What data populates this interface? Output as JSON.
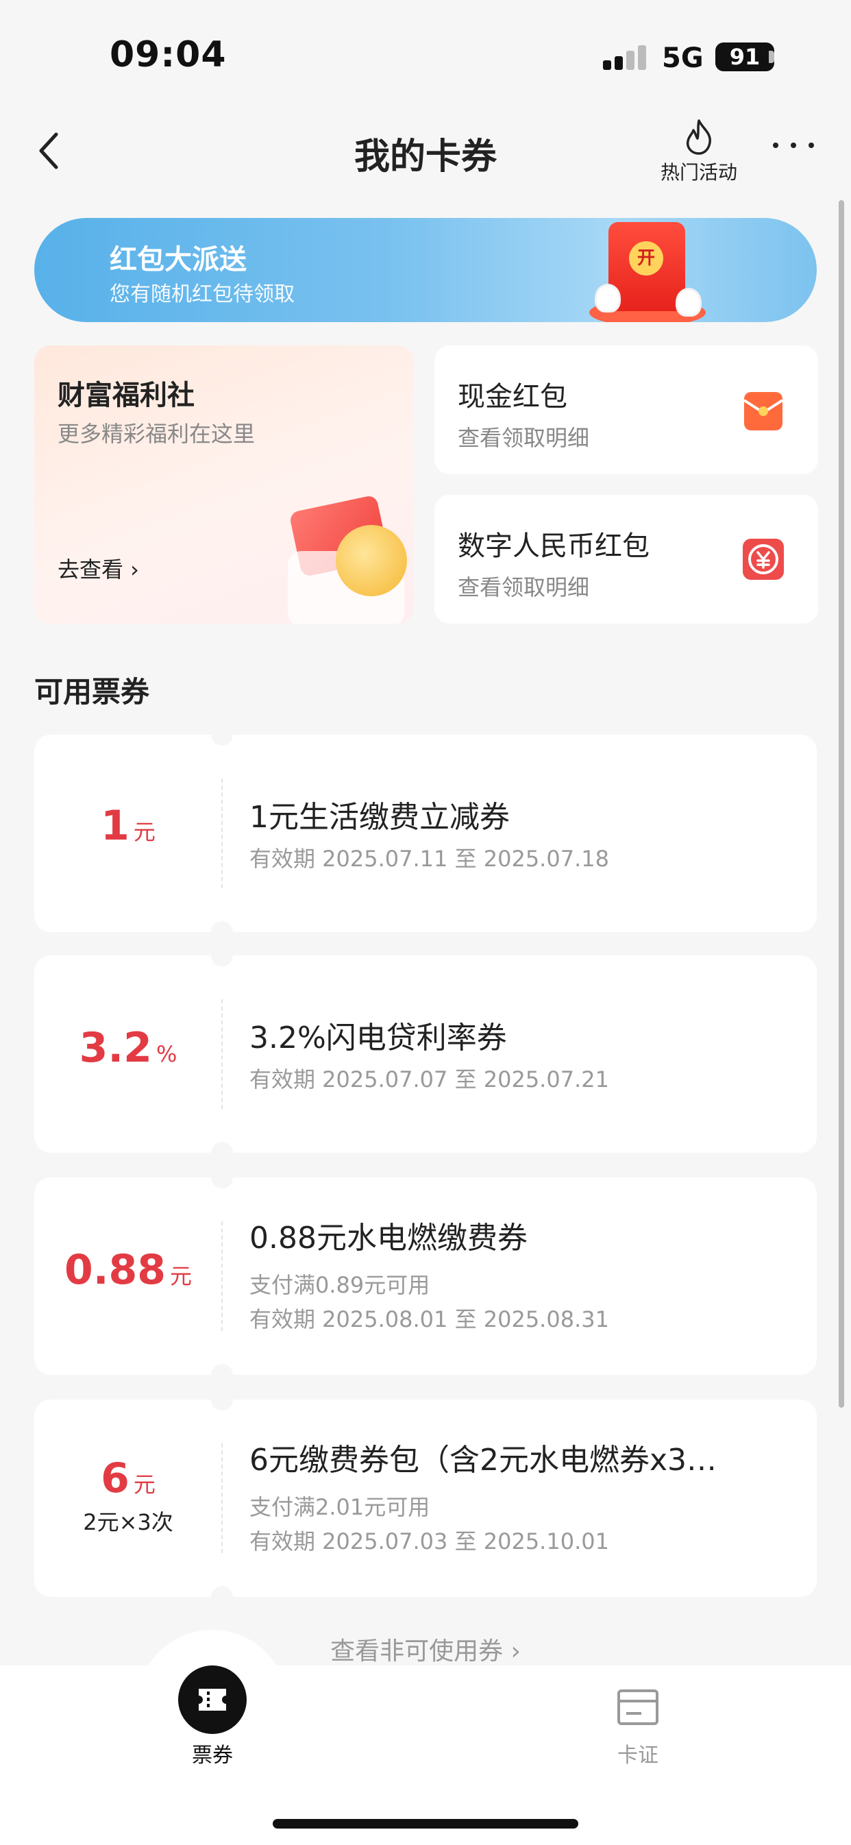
{
  "status_bar": {
    "time": "09:04",
    "network": "5G",
    "battery": "91"
  },
  "nav": {
    "title": "我的卡券",
    "hot_label": "热门活动"
  },
  "banner": {
    "title": "红包大派送",
    "subtitle": "您有随机红包待领取",
    "seal": "开"
  },
  "wealth": {
    "title": "财富福利社",
    "subtitle": "更多精彩福利在这里",
    "link": "去查看 ›"
  },
  "cash_redpacket": {
    "title": "现金红包",
    "subtitle": "查看领取明细"
  },
  "ecny_redpacket": {
    "title": "数字人民币红包",
    "subtitle": "查看领取明细"
  },
  "section": {
    "title": "可用票券"
  },
  "coupons": [
    {
      "amount": "1",
      "unit": "元",
      "note": "",
      "title": "1元生活缴费立减券",
      "condition": "",
      "validity": "有效期 2025.07.11 至 2025.07.18"
    },
    {
      "amount": "3.2",
      "unit": "%",
      "note": "",
      "title": "3.2%闪电贷利率券",
      "condition": "",
      "validity": "有效期 2025.07.07 至 2025.07.21"
    },
    {
      "amount": "0.88",
      "unit": "元",
      "note": "",
      "title": "0.88元水电燃缴费券",
      "condition": "支付满0.89元可用",
      "validity": "有效期 2025.08.01 至 2025.08.31"
    },
    {
      "amount": "6",
      "unit": "元",
      "note": "2元×3次",
      "title": "6元缴费券包（含2元水电燃券x3…",
      "condition": "支付满2.01元可用",
      "validity": "有效期 2025.07.03 至 2025.10.01"
    }
  ],
  "view_more": "查看非可使用券 ›",
  "tabbar": {
    "tab1": "票券",
    "tab2": "卡证"
  },
  "colors": {
    "accent_red": "#e23b44",
    "banner_blue": "#6bbbee"
  }
}
